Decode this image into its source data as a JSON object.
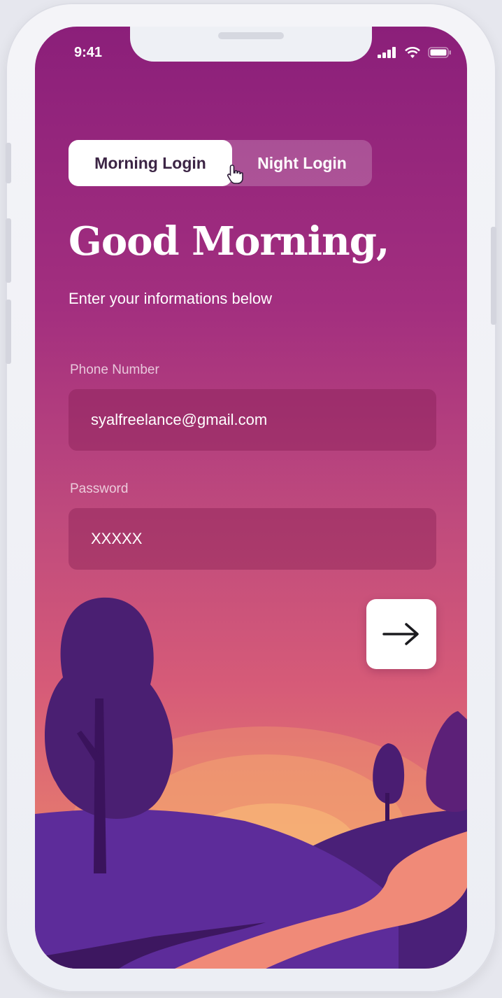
{
  "status_bar": {
    "time": "9:41",
    "icons": [
      "signal-icon",
      "wifi-icon",
      "battery-icon"
    ]
  },
  "login_toggle": {
    "options": [
      "Morning Login",
      "Night Login"
    ],
    "selected": "Morning Login"
  },
  "main": {
    "greeting": "Good Morning,",
    "subtitle": "Enter your informations below"
  },
  "form": {
    "phone": {
      "label": "Phone Number",
      "value": "syalfreelance@gmail.com"
    },
    "password": {
      "label": "Password",
      "value": "XXXXX"
    },
    "submit_icon": "arrow-right-icon"
  },
  "colors": {
    "background_top": "#8b1f7a",
    "background_bottom": "#f19a70",
    "hills": "#5a2a94",
    "trees": "#4a1f6e",
    "sun": "#f7a36f"
  }
}
